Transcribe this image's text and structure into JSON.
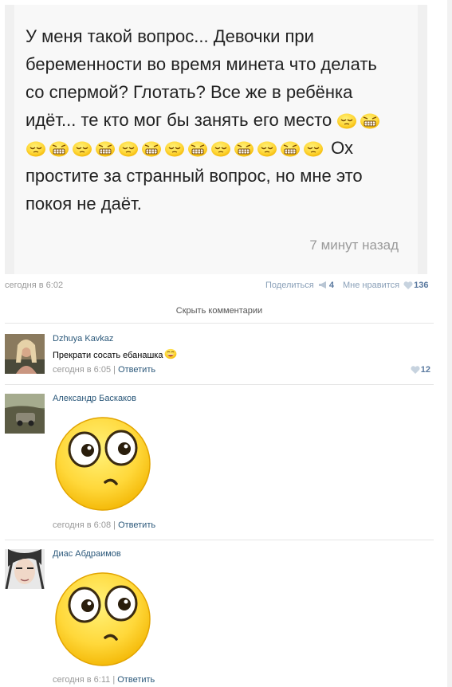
{
  "post": {
    "text_line1": "У меня такой вопрос... Девочки при",
    "text_line2": "беременности во время минета что делать",
    "text_line3": "со спермой? Глотать? Все же в ребёнка",
    "text_line4": "идёт... те кто мог бы занять его место",
    "text_line5_tail": "Ох",
    "text_line6": "простите за странный вопрос, но мне это",
    "text_line7": "покоя не даёт.",
    "time_ago": "7 минут назад",
    "emoji_colors": {
      "face": "#ffd13a",
      "outline": "#e0a800"
    }
  },
  "post_meta": {
    "date": "сегодня в 6:02",
    "share_label": "Поделиться",
    "share_count": "4",
    "likes_label": "Мне нравится",
    "likes_count": "136"
  },
  "hide_comments_label": "Скрыть комментарии",
  "comments": [
    {
      "author": "Dzhuya Kavkaz",
      "text": "Прекрати сосать ебанашка",
      "date": "сегодня в 6:05",
      "separator": "|",
      "reply_label": "Ответить",
      "likes": "12"
    },
    {
      "author": "Александр Баскаков",
      "sticker": "confused-face-sticker",
      "date": "сегодня в 6:08",
      "separator": "|",
      "reply_label": "Ответить"
    },
    {
      "author": "Диас Абдраимов",
      "sticker": "confused-face-sticker",
      "date": "сегодня в 6:11",
      "separator": "|",
      "reply_label": "Ответить"
    }
  ],
  "colors": {
    "link": "#2b587a",
    "muted": "#999999",
    "sticker_yellow": "#ffd84a"
  }
}
